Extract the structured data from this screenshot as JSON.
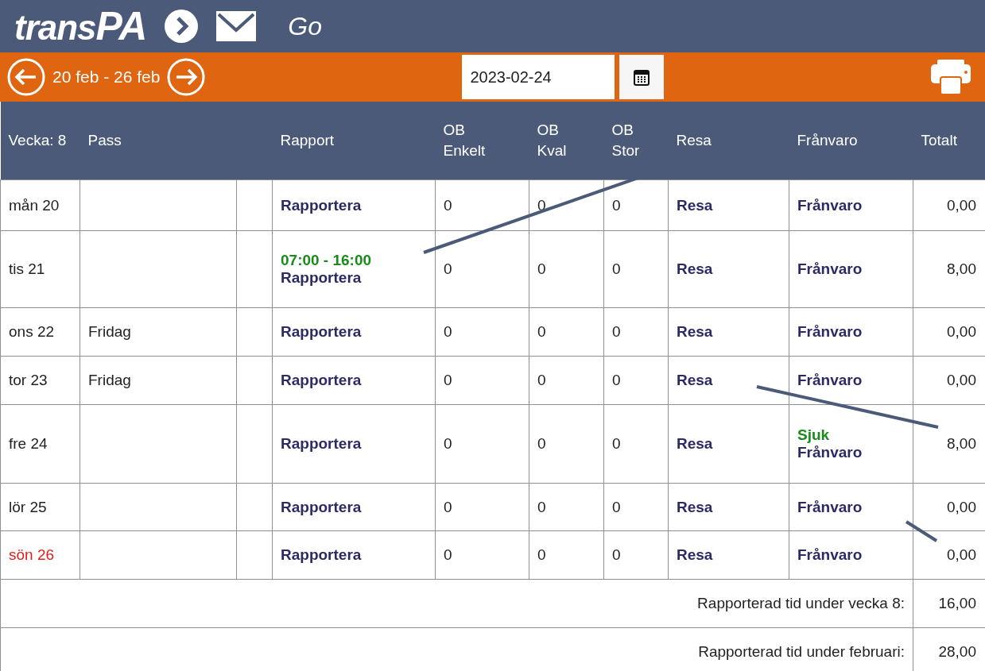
{
  "header": {
    "logo_prefix": "trans",
    "logo_suffix": "PA",
    "go_label": "Go"
  },
  "week_bar": {
    "range": "20 feb - 26 feb",
    "date": "2023-02-24"
  },
  "table": {
    "columns": [
      "Vecka: 8",
      "Pass",
      "",
      "Rapport",
      "OB\nEnkelt",
      "OB\nKval",
      "OB\nStor",
      "Resa",
      "Frånvaro",
      "Totalt"
    ],
    "rows": [
      {
        "day": "mån 20",
        "red_day": false,
        "pass": "",
        "report_time": "",
        "report": "Rapportera",
        "ob_enkelt": "0",
        "ob_kval": "0",
        "ob_stor": "0",
        "travel": "Resa",
        "absence_note": "",
        "absence": "Frånvaro",
        "total": "0,00"
      },
      {
        "day": "tis 21",
        "red_day": false,
        "pass": "",
        "report_time": "07:00 - 16:00",
        "report": "Rapportera",
        "ob_enkelt": "0",
        "ob_kval": "0",
        "ob_stor": "0",
        "travel": "Resa",
        "absence_note": "",
        "absence": "Frånvaro",
        "total": "8,00"
      },
      {
        "day": "ons 22",
        "red_day": false,
        "pass": "Fridag",
        "report_time": "",
        "report": "Rapportera",
        "ob_enkelt": "0",
        "ob_kval": "0",
        "ob_stor": "0",
        "travel": "Resa",
        "absence_note": "",
        "absence": "Frånvaro",
        "total": "0,00"
      },
      {
        "day": "tor 23",
        "red_day": false,
        "pass": "Fridag",
        "report_time": "",
        "report": "Rapportera",
        "ob_enkelt": "0",
        "ob_kval": "0",
        "ob_stor": "0",
        "travel": "Resa",
        "absence_note": "",
        "absence": "Frånvaro",
        "total": "0,00"
      },
      {
        "day": "fre 24",
        "red_day": false,
        "pass": "",
        "report_time": "",
        "report": "Rapportera",
        "ob_enkelt": "0",
        "ob_kval": "0",
        "ob_stor": "0",
        "travel": "Resa",
        "absence_note": "Sjuk",
        "absence": "Frånvaro",
        "total": "8,00"
      },
      {
        "day": "lör 25",
        "red_day": false,
        "pass": "",
        "report_time": "",
        "report": "Rapportera",
        "ob_enkelt": "0",
        "ob_kval": "0",
        "ob_stor": "0",
        "travel": "Resa",
        "absence_note": "",
        "absence": "Frånvaro",
        "total": "0,00"
      },
      {
        "day": "sön 26",
        "red_day": true,
        "pass": "",
        "report_time": "",
        "report": "Rapportera",
        "ob_enkelt": "0",
        "ob_kval": "0",
        "ob_stor": "0",
        "travel": "Resa",
        "absence_note": "",
        "absence": "Frånvaro",
        "total": "0,00"
      }
    ],
    "summaries": [
      {
        "label": "Rapporterad tid under vecka 8:",
        "value": "16,00"
      },
      {
        "label": "Rapporterad tid under februari:",
        "value": "28,00"
      }
    ]
  }
}
